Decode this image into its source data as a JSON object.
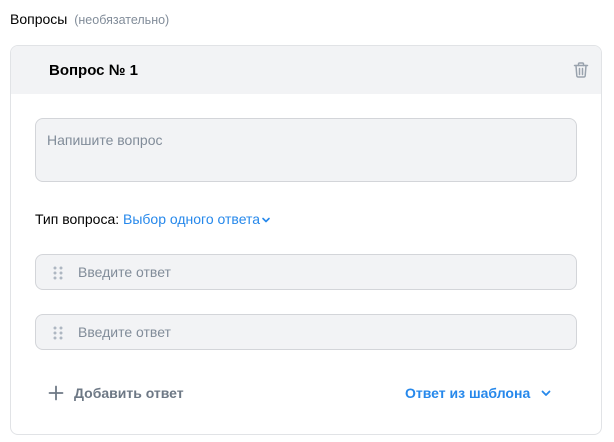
{
  "section": {
    "title": "Вопросы",
    "optional_label": "(необязательно)"
  },
  "question": {
    "title": "Вопрос № 1",
    "placeholder": "Напишите вопрос",
    "type_label": "Тип вопроса:",
    "type_value": "Выбор одного ответа"
  },
  "answers": [
    {
      "placeholder": "Введите ответ"
    },
    {
      "placeholder": "Введите ответ"
    }
  ],
  "actions": {
    "add_answer": "Добавить ответ",
    "from_template": "Ответ из шаблона"
  },
  "icons": {
    "trash": "trash-icon",
    "chevron": "chevron-down-icon",
    "drag": "drag-handle-icon",
    "plus": "plus-icon"
  },
  "colors": {
    "accent": "#2688eb",
    "secondary_text": "#818c99",
    "field_background": "#f2f3f5",
    "border": "#d3d5d9"
  }
}
